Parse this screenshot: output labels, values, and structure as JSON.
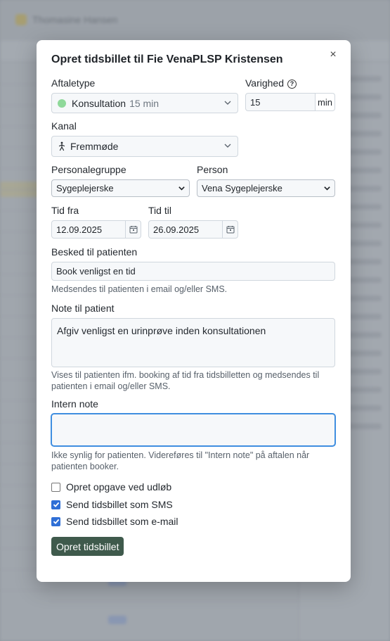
{
  "background": {
    "user_name": "Thomasine Hansen"
  },
  "modal": {
    "title": "Opret tidsbillet til Fie VenaPLSP Kristensen",
    "close_symbol": "×",
    "appointment_type": {
      "label": "Aftaletype",
      "value": "Konsultation",
      "duration_note": "15 min",
      "color": "#8fd99a"
    },
    "duration": {
      "label": "Varighed",
      "value": "15",
      "unit": "min",
      "help_symbol": "?"
    },
    "channel": {
      "label": "Kanal",
      "value": "Fremmøde",
      "icon": "person-walking-icon"
    },
    "staff_group": {
      "label": "Personalegruppe",
      "value": "Sygeplejerske"
    },
    "person": {
      "label": "Person",
      "value": "Vena Sygeplejerske"
    },
    "date_from": {
      "label": "Tid fra",
      "value": "12.09.2025"
    },
    "date_to": {
      "label": "Tid til",
      "value": "26.09.2025"
    },
    "patient_message": {
      "label": "Besked til patienten",
      "value": "Book venligst en tid",
      "hint": "Medsendes til patienten i email og/eller SMS."
    },
    "patient_note": {
      "label": "Note til patient",
      "value": "Afgiv venligst en urinprøve inden konsultationen",
      "hint": "Vises til patienten ifm. booking af tid fra tidsbilletten og medsendes til patienten i email og/eller SMS."
    },
    "internal_note": {
      "label": "Intern note",
      "value": "",
      "hint": "Ikke synlig for patienten. Videreføres til \"Intern note\" på aftalen når patienten booker."
    },
    "checkboxes": [
      {
        "label": "Opret opgave ved udløb",
        "checked": false
      },
      {
        "label": "Send tidsbillet som SMS",
        "checked": true
      },
      {
        "label": "Send tidsbillet som e-mail",
        "checked": true
      }
    ],
    "submit_label": "Opret tidsbillet",
    "accent_color": "#3f5a4c",
    "focus_color": "#3f8ee0",
    "checkbox_color": "#2f6fd6"
  }
}
